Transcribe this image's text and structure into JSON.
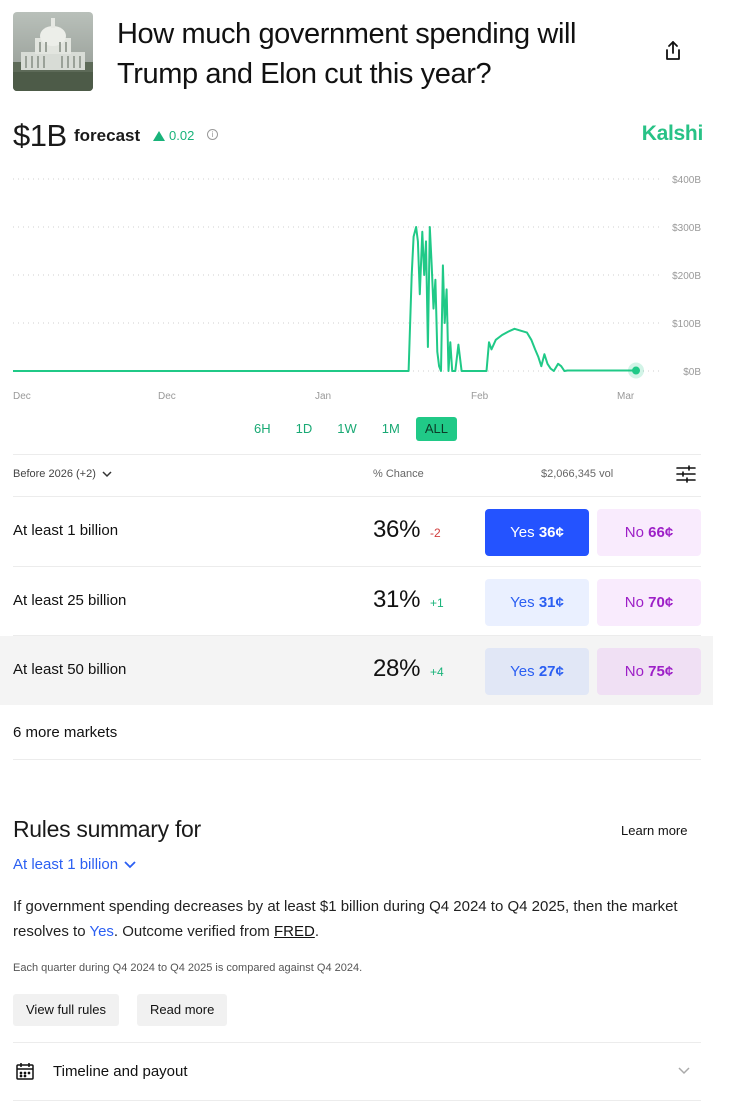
{
  "header": {
    "title": "How much government spending will Trump and Elon cut this year?"
  },
  "forecast": {
    "value": "$1B",
    "label": "forecast",
    "delta": "0.02",
    "brand": "Kalshi",
    "accent_color": "#20c987"
  },
  "chart_data": {
    "type": "line",
    "title": "",
    "xlabel": "",
    "ylabel": "",
    "x_ticks": [
      "Dec",
      "Dec",
      "Jan",
      "Feb",
      "Mar"
    ],
    "y_ticks": [
      "$400B",
      "$300B",
      "$200B",
      "$100B",
      "$0B"
    ],
    "ylim": [
      0,
      400
    ],
    "y_unit": "$B",
    "grid": true,
    "series": [
      {
        "color": "#20c987",
        "points": [
          [
            0.0,
            0
          ],
          [
            0.05,
            0
          ],
          [
            0.1,
            0
          ],
          [
            0.15,
            0
          ],
          [
            0.2,
            0
          ],
          [
            0.25,
            0
          ],
          [
            0.3,
            0
          ],
          [
            0.35,
            0
          ],
          [
            0.4,
            0
          ],
          [
            0.45,
            0
          ],
          [
            0.5,
            0
          ],
          [
            0.55,
            0
          ],
          [
            0.6,
            0
          ],
          [
            0.62,
            0
          ],
          [
            0.635,
            0
          ],
          [
            0.64,
            200
          ],
          [
            0.643,
            280
          ],
          [
            0.647,
            300
          ],
          [
            0.65,
            270
          ],
          [
            0.653,
            160
          ],
          [
            0.657,
            290
          ],
          [
            0.66,
            200
          ],
          [
            0.663,
            270
          ],
          [
            0.666,
            50
          ],
          [
            0.669,
            300
          ],
          [
            0.672,
            220
          ],
          [
            0.675,
            130
          ],
          [
            0.678,
            190
          ],
          [
            0.681,
            40
          ],
          [
            0.684,
            10
          ],
          [
            0.687,
            0
          ],
          [
            0.69,
            220
          ],
          [
            0.693,
            100
          ],
          [
            0.696,
            170
          ],
          [
            0.699,
            0
          ],
          [
            0.702,
            60
          ],
          [
            0.705,
            0
          ],
          [
            0.71,
            0
          ],
          [
            0.715,
            55
          ],
          [
            0.72,
            0
          ],
          [
            0.725,
            0
          ],
          [
            0.76,
            0
          ],
          [
            0.764,
            60
          ],
          [
            0.768,
            45
          ],
          [
            0.775,
            65
          ],
          [
            0.785,
            75
          ],
          [
            0.795,
            82
          ],
          [
            0.805,
            88
          ],
          [
            0.815,
            84
          ],
          [
            0.825,
            80
          ],
          [
            0.832,
            65
          ],
          [
            0.838,
            45
          ],
          [
            0.843,
            30
          ],
          [
            0.848,
            10
          ],
          [
            0.853,
            35
          ],
          [
            0.858,
            15
          ],
          [
            0.863,
            5
          ],
          [
            0.868,
            0
          ],
          [
            0.875,
            15
          ],
          [
            0.88,
            10
          ],
          [
            0.885,
            0
          ],
          [
            0.89,
            1
          ],
          [
            0.93,
            1
          ],
          [
            0.96,
            1
          ],
          [
            1.0,
            1
          ]
        ]
      }
    ]
  },
  "ranges": [
    "6H",
    "1D",
    "1W",
    "1M",
    "ALL"
  ],
  "active_range": "ALL",
  "market_header": {
    "filter": "Before 2026 (+2)",
    "chance": "% Chance",
    "volume": "$2,066,345 vol"
  },
  "markets": [
    {
      "label": "At least 1 billion",
      "pct": "36%",
      "change": "-2",
      "yes": "36¢",
      "no": "66¢"
    },
    {
      "label": "At least 25 billion",
      "pct": "31%",
      "change": "+1",
      "yes": "31¢",
      "no": "70¢"
    },
    {
      "label": "At least 50 billion",
      "pct": "28%",
      "change": "+4",
      "yes": "27¢",
      "no": "75¢"
    }
  ],
  "labels": {
    "yes": "Yes",
    "no": "No"
  },
  "more_markets": "6 more markets",
  "rules": {
    "title": "Rules summary for",
    "learn_more": "Learn more",
    "selected": "At least 1 billion",
    "text_before": "If government spending decreases by at least $1 billion during Q4 2024 to Q4 2025, then the market resolves to ",
    "yes_link": "Yes",
    "text_middle": ". Outcome verified from ",
    "fred_link": "FRED",
    "text_end": ".",
    "note": "Each quarter during Q4 2024 to Q4 2025 is compared against Q4 2024.",
    "view_full": "View full rules",
    "read_more": "Read more"
  },
  "timeline": {
    "label": "Timeline and payout"
  }
}
